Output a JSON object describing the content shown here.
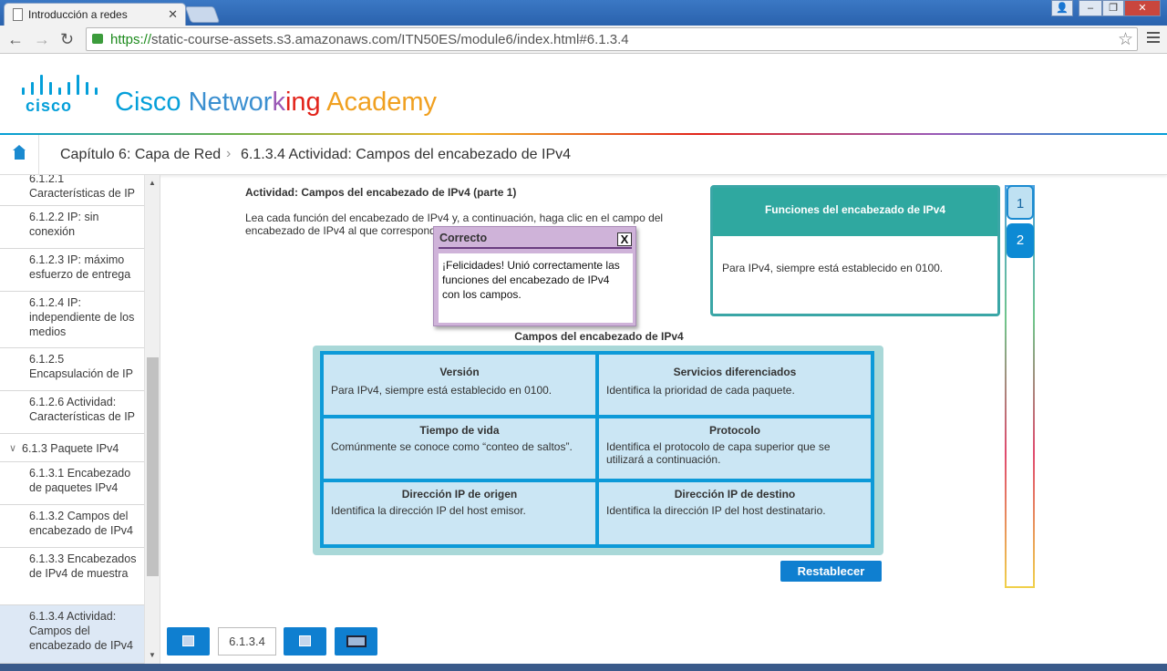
{
  "browser": {
    "tab_title": "Introducción a redes",
    "url_scheme": "https://",
    "url_rest": "static-course-assets.s3.amazonaws.com/ITN50ES/module6/index.html#6.1.3.4"
  },
  "header": {
    "logo_text": "cisco",
    "academy_words": [
      {
        "text": "Cisco ",
        "color": "#049fd9"
      },
      {
        "text": "Networ",
        "color": "#3b8fd0"
      },
      {
        "text": "k",
        "color": "#9b59b6"
      },
      {
        "text": "ing ",
        "color": "#e2231a"
      },
      {
        "text": "Academy",
        "color": "#f0a020"
      }
    ]
  },
  "breadcrumb": {
    "chapter": "Capítulo 6: Capa de Red",
    "page": "6.1.3.4 Actividad: Campos del encabezado de IPv4"
  },
  "sidebar": {
    "items": [
      {
        "label": "6.1.2.1 Características de IP",
        "active": false
      },
      {
        "label": "6.1.2.2 IP: sin conexión",
        "active": false
      },
      {
        "label": "6.1.2.3 IP: máximo esfuerzo de entrega",
        "active": false
      },
      {
        "label": "6.1.2.4 IP: independiente de los medios",
        "active": false
      },
      {
        "label": "6.1.2.5 Encapsulación de IP",
        "active": false
      },
      {
        "label": "6.1.2.6 Actividad: Características de IP",
        "active": false
      },
      {
        "label": "6.1.3 Paquete IPv4",
        "active": false
      },
      {
        "label": "6.1.3.1 Encabezado de paquetes IPv4",
        "active": false
      },
      {
        "label": "6.1.3.2 Campos del encabezado de IPv4",
        "active": false
      },
      {
        "label": "6.1.3.3 Encabezados de IPv4 de muestra",
        "active": false
      },
      {
        "label": "6.1.3.4 Actividad: Campos del encabezado de IPv4",
        "active": true
      }
    ]
  },
  "activity": {
    "title": "Actividad: Campos del encabezado de IPv4 (parte 1)",
    "instructions": "Lea cada función del encabezado de IPv4 y, a continuación, haga clic en el campo del encabezado de IPv4 al que corresponde."
  },
  "functions_panel": {
    "title": "Funciones del encabezado de IPv4",
    "text": "Para IPv4, siempre está establecido en 0100."
  },
  "grid": {
    "title": "Campos del encabezado de IPv4",
    "cells": [
      {
        "name": "Versión",
        "desc": "Para IPv4, siempre está establecido en 0100."
      },
      {
        "name": "Servicios diferenciados",
        "desc": "Identifica la prioridad de cada paquete."
      },
      {
        "name": "Tiempo de vida",
        "desc": "Comúnmente se conoce como “conteo de saltos”."
      },
      {
        "name": "Protocolo",
        "desc": "Identifica el protocolo de capa superior que se utilizará a continuación."
      },
      {
        "name": "Dirección IP de origen",
        "desc": "Identifica la dirección IP del host emisor."
      },
      {
        "name": "Dirección IP de destino",
        "desc": "Identifica la dirección IP del host destinatario."
      }
    ]
  },
  "reset_label": "Restablecer",
  "pages": [
    "1",
    "2"
  ],
  "current_page_number": "6.1.3.4",
  "popup": {
    "title": "Correcto",
    "close": "X",
    "message": "¡Felicidades! Unió correctamente las funciones del encabezado de IPv4 con los campos."
  }
}
